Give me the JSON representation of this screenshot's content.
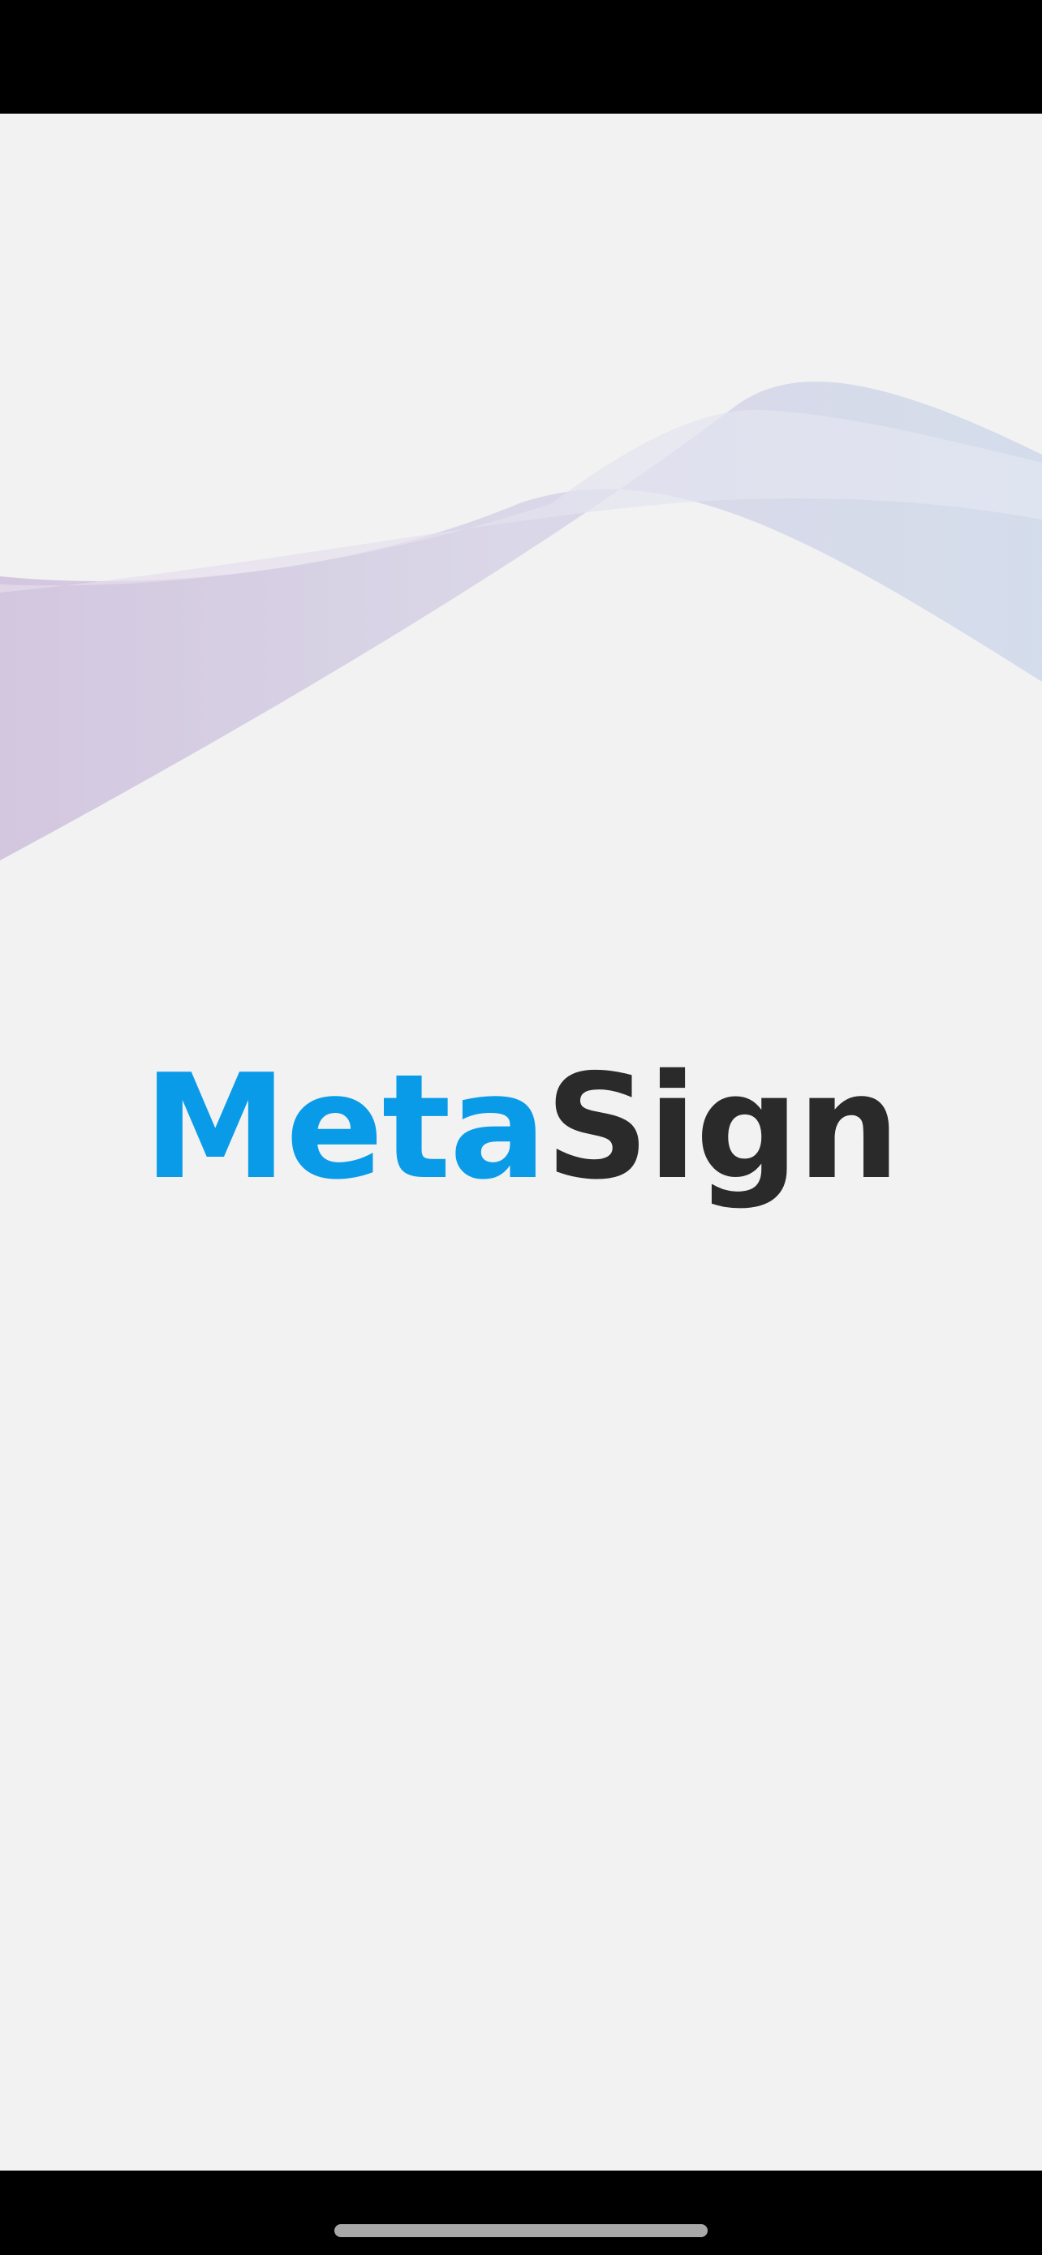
{
  "app": {
    "brand_part_1": "Meta",
    "brand_part_2": "Sign"
  },
  "colors": {
    "brand_primary": "#0a9be8",
    "brand_dark": "#2a2a2a",
    "background": "#f2f2f2",
    "system_bars": "#000000"
  }
}
